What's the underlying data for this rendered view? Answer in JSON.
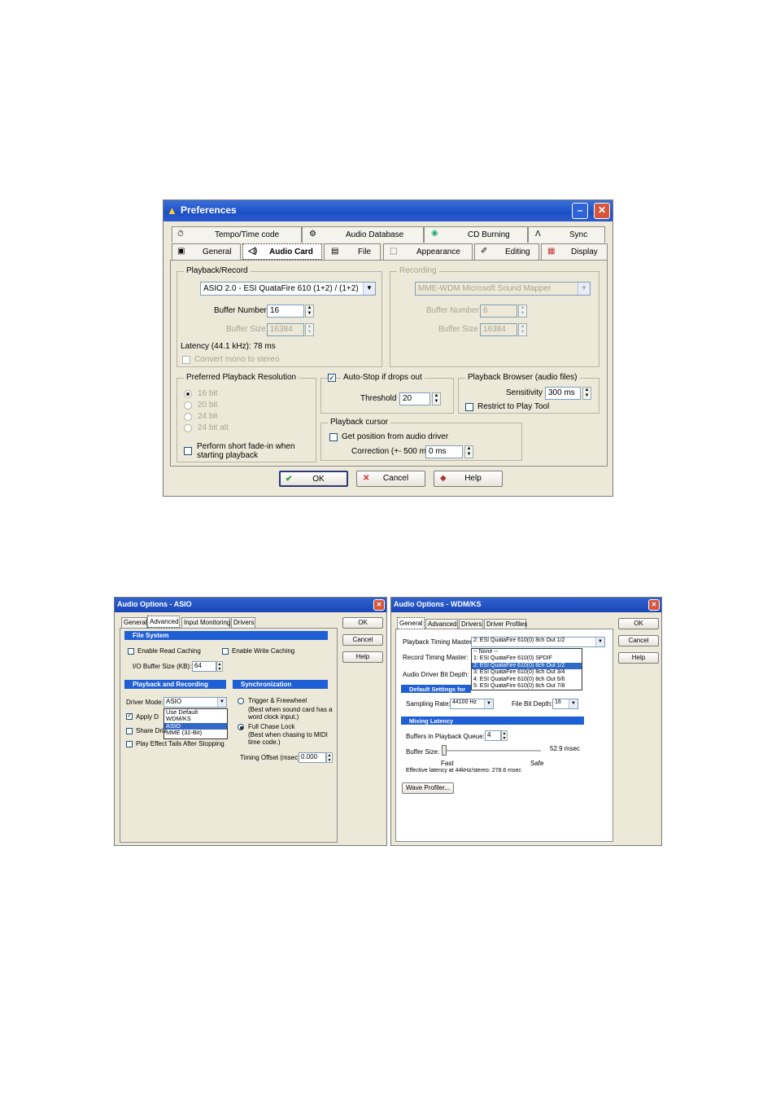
{
  "preferences": {
    "title": "Preferences",
    "tabs_row1": [
      "Tempo/Time code",
      "Audio Database",
      "CD Burning",
      "Sync"
    ],
    "tabs_row2": [
      "General",
      "Audio Card",
      "File",
      "Appearance",
      "Editing",
      "Display"
    ],
    "selected_tab": "Audio Card",
    "playback_record": {
      "label": "Playback/Record",
      "device": "ASIO 2.0 - ESI QuataFire 610 (1+2) / (1+2)",
      "buffer_number_label": "Buffer Number",
      "buffer_number": "16",
      "buffer_size_label": "Buffer Size",
      "buffer_size": "16384",
      "latency": "Latency (44.1 kHz): 78 ms",
      "convert_mono": "Convert mono to stereo"
    },
    "recording": {
      "label": "Recording",
      "device": "MME-WDM Microsoft Sound Mapper",
      "buffer_number_label": "Buffer Number",
      "buffer_number": "6",
      "buffer_size_label": "Buffer Size",
      "buffer_size": "16384"
    },
    "resolution": {
      "label": "Preferred Playback Resolution",
      "options": [
        "16 bit",
        "20 bit",
        "24 bit",
        "24 bit alt"
      ],
      "selected": "16 bit",
      "fade_in": "Perform short fade-in when starting playback"
    },
    "auto_stop": {
      "label": "Auto-Stop if drops out",
      "checked": true,
      "threshold_label": "Threshold",
      "threshold": "20"
    },
    "playback_browser": {
      "label": "Playback Browser (audio files)",
      "sensitivity_label": "Sensitivity",
      "sensitivity": "300 ms",
      "restrict": "Restrict to Play Tool"
    },
    "playback_cursor": {
      "label": "Playback cursor",
      "get_position": "Get position from audio driver",
      "correction_label": "Correction (+- 500 ms)",
      "correction": "0 ms"
    },
    "buttons": {
      "ok": "OK",
      "cancel": "Cancel",
      "help": "Help"
    }
  },
  "asio": {
    "title": "Audio Options - ASIO",
    "tabs": [
      "General",
      "Advanced",
      "Input Monitoring",
      "Drivers"
    ],
    "selected_tab": "Advanced",
    "file_system": "File System",
    "enable_read": "Enable Read Caching",
    "enable_write": "Enable Write Caching",
    "io_buffer_label": "I/O Buffer Size (KB):",
    "io_buffer": "64",
    "playback_recording": "Playback and Recording",
    "synchronization": "Synchronization",
    "driver_mode_label": "Driver Mode:",
    "driver_mode": "ASIO",
    "driver_options": [
      "Use Default",
      "WDM/KS",
      "ASIO",
      "MME (32-Bit)"
    ],
    "apply_dither": "Apply D",
    "share_drivers": "Share Driv",
    "play_effect_tails": "Play Effect Tails After Stopping",
    "trigger": "Trigger & Freewheel",
    "trigger_note": "(Best when sound card has a word clock input.)",
    "full_chase": "Full Chase Lock",
    "full_chase_note": "(Best when chasing to MIDI time code.)",
    "timing_offset_label": "Timing Offset (msec):",
    "timing_offset": "0.000",
    "buttons": {
      "ok": "OK",
      "cancel": "Cancel",
      "help": "Help"
    }
  },
  "wdm": {
    "title": "Audio Options - WDM/KS",
    "tabs": [
      "General",
      "Advanced",
      "Drivers",
      "Driver Profiles"
    ],
    "selected_tab": "General",
    "playback_master_label": "Playback Timing Master:",
    "playback_master": "2: ESI QuataFire 610(0) 8ch Out 1/2",
    "record_master_label": "Record Timing Master:",
    "bit_depth_label": "Audio Driver Bit Depth:",
    "master_options": [
      "-- None --",
      "1: ESI QuataFire 610(0) SPDIF",
      "2: ESI QuataFire 610(0) 8ch Out 1/2",
      "3: ESI QuataFire 610(0) 8ch Out 3/4",
      "4: ESI QuataFire 610(0) 8ch Out 5/6",
      "5: ESI QuataFire 610(0) 8ch Out 7/8"
    ],
    "default_settings": "Default Settings for",
    "sampling_rate_label": "Sampling Rate:",
    "sampling_rate": "44100 Hz",
    "file_bit_depth_label": "File Bit Depth:",
    "file_bit_depth": "16",
    "mixing_latency": "Mixing Latency",
    "buffers_label": "Buffers in Playback Queue:",
    "buffers": "4",
    "buffer_size_label": "Buffer Size:",
    "buffer_size": "52.9 msec",
    "fast": "Fast",
    "safe": "Safe",
    "effective": "Effective latency at 44kHz/stereo:  278.6 msec",
    "wave_profiler": "Wave Profiler...",
    "buttons": {
      "ok": "OK",
      "cancel": "Cancel",
      "help": "Help"
    }
  },
  "colors": {
    "titlebar": "#2058cc",
    "highlight": "#316ac5",
    "dialog": "#ece9d8"
  }
}
